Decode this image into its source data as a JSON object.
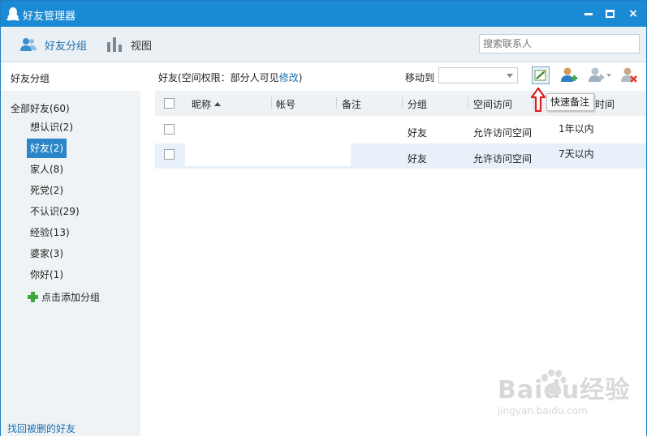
{
  "window": {
    "title": "好友管理器",
    "minimize_label": "",
    "maximize_label": "",
    "close_label": "×"
  },
  "toolbar": {
    "groups_tab": "好友分组",
    "view_tab": "视图",
    "search_placeholder": "搜索联系人"
  },
  "sidebar": {
    "header": "好友分组",
    "all_friends": "全部好友(60)",
    "items": [
      {
        "label": "想认识(2)",
        "active": false
      },
      {
        "label": "好友(2)",
        "active": true
      },
      {
        "label": "家人(8)",
        "active": false
      },
      {
        "label": "死党(2)",
        "active": false
      },
      {
        "label": "不认识(29)",
        "active": false
      },
      {
        "label": "经验(13)",
        "active": false
      },
      {
        "label": "婆家(3)",
        "active": false
      },
      {
        "label": "你好(1)",
        "active": false
      }
    ],
    "add_group": "点击添加分组",
    "recover": "找回被删的好友"
  },
  "main": {
    "permission_text": "好友(空间权限：部分人可见",
    "permission_link": "修改",
    "permission_close": ")",
    "move_to_label": "移动到",
    "move_to_value": "",
    "tooltip": "快速备注",
    "columns": {
      "nickname": "昵称",
      "account": "帐号",
      "remark": "备注",
      "group": "分组",
      "space_access": "空间访问",
      "time_suffix": "时间"
    },
    "rows": [
      {
        "group": "好友",
        "space_access": "允许访问空间",
        "time": "1年以内"
      },
      {
        "group": "好友",
        "space_access": "允许访问空间",
        "time": "7天以内"
      }
    ]
  },
  "watermark": {
    "brand": "Baidu经验",
    "url": "jingyan.baidu.com"
  },
  "colors": {
    "titlebar": "#1a8ad4",
    "accent": "#2b85c9",
    "link": "#1a6fb0",
    "selected_row": "#e8f1fa",
    "arrow": "#e01b1b"
  }
}
